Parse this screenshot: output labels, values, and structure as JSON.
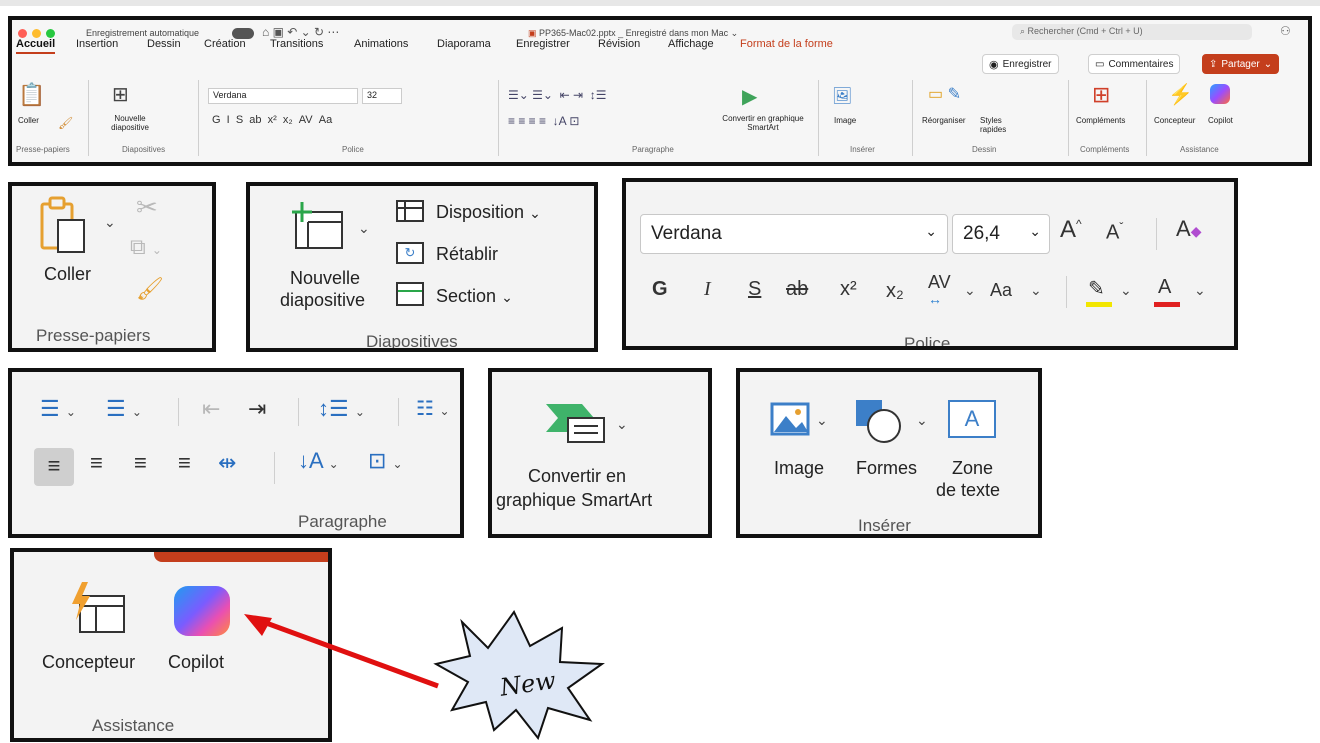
{
  "titlebar": {
    "autosave": "Enregistrement automatique",
    "doc_title": "PP365-Mac02.pptx _ Enregistré dans mon Mac",
    "search_placeholder": "Rechercher (Cmd + Ctrl + U)"
  },
  "tabs": [
    "Accueil",
    "Insertion",
    "Dessin",
    "Création",
    "Transitions",
    "Animations",
    "Diaporama",
    "Enregistrer",
    "Révision",
    "Affichage",
    "Format de la forme"
  ],
  "actions": {
    "record": "Enregistrer",
    "comments": "Commentaires",
    "share": "Partager"
  },
  "ribbon": {
    "paste": "Coller",
    "new_slide": "Nouvelle diapositive",
    "font_name": "Verdana",
    "font_size": "32",
    "smartart": "Convertir en graphique SmartArt",
    "image": "Image",
    "arrange": "Réorganiser",
    "quick_styles": "Styles rapides",
    "addins": "Compléments",
    "designer": "Concepteur",
    "copilot": "Copilot",
    "groups": {
      "clipboard": "Presse-papiers",
      "slides": "Diapositives",
      "font": "Police",
      "paragraph": "Paragraphe",
      "insert": "Insérer",
      "drawing": "Dessin",
      "addins": "Compléments",
      "assistance": "Assistance"
    }
  },
  "zoom_clipboard": {
    "paste": "Coller",
    "group": "Presse-papiers"
  },
  "zoom_slides": {
    "new1": "Nouvelle",
    "new2": "diapositive",
    "layout": "Disposition",
    "reset": "Rétablir",
    "section": "Section",
    "group": "Diapositives"
  },
  "zoom_font": {
    "font_name": "Verdana",
    "font_size": "26,4",
    "bold": "G",
    "italic": "I",
    "underline": "S",
    "strike": "ab",
    "sup": "x²",
    "sub": "x₂",
    "spacing": "AV",
    "case": "Aa",
    "group": "Police"
  },
  "zoom_paragraph": {
    "group": "Paragraphe"
  },
  "zoom_smartart": {
    "line1": "Convertir en",
    "line2": "graphique SmartArt"
  },
  "zoom_insert": {
    "image": "Image",
    "shapes": "Formes",
    "textbox1": "Zone",
    "textbox2": "de texte",
    "group": "Insérer"
  },
  "zoom_assistance": {
    "designer": "Concepteur",
    "copilot": "Copilot",
    "group": "Assistance"
  },
  "callout": {
    "text": "New"
  },
  "colors": {
    "accent": "#c43e1c",
    "highlight": "#f2e600",
    "font_red": "#e02020",
    "arrow": "#e01010"
  }
}
